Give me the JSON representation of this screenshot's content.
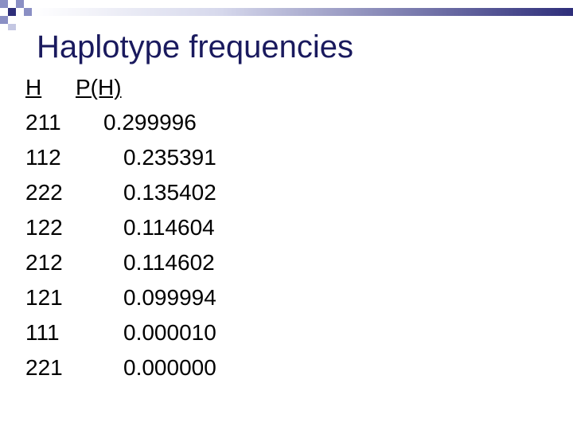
{
  "slide": {
    "title": "Haplotype frequencies",
    "header_h": "H",
    "header_p": "P(H)",
    "rows": [
      {
        "haplotype": "211",
        "frequency": "0.299996"
      },
      {
        "haplotype": "112",
        "frequency": "0.235391"
      },
      {
        "haplotype": "222",
        "frequency": "0.135402"
      },
      {
        "haplotype": "122",
        "frequency": "0.114604"
      },
      {
        "haplotype": "212",
        "frequency": "0.114602"
      },
      {
        "haplotype": "121",
        "frequency": "0.099994"
      },
      {
        "haplotype": "111",
        "frequency": "0.000010"
      },
      {
        "haplotype": "221",
        "frequency": "0.000000"
      }
    ]
  },
  "theme": {
    "title_color": "#1a1a5e",
    "bar_color": "#2e2e7a",
    "square_color": "#8a8fc4"
  }
}
